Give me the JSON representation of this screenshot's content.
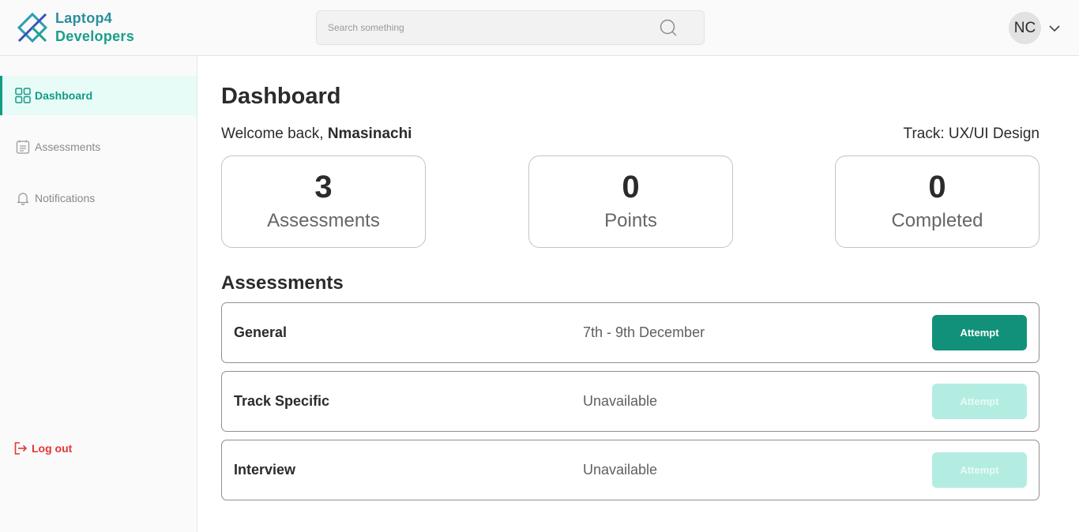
{
  "brand": {
    "line1": "Laptop4",
    "line2": "Developers",
    "colors": {
      "primary": "#139b85",
      "logo_blue": "#3a4fb8",
      "logout_red": "#e53535"
    }
  },
  "search": {
    "placeholder": "Search something",
    "value": "",
    "icon": "search-icon"
  },
  "user": {
    "initials": "NC",
    "menu_icon": "chevron-down-icon"
  },
  "sidebar": {
    "items": [
      {
        "label": "Dashboard",
        "icon": "dashboard-grid-icon",
        "active": true
      },
      {
        "label": "Assessments",
        "icon": "clipboard-list-icon",
        "active": false
      },
      {
        "label": "Notifications",
        "icon": "bell-icon",
        "active": false
      }
    ],
    "logout": {
      "label": "Log out",
      "icon": "logout-icon"
    }
  },
  "main": {
    "title": "Dashboard",
    "welcome_prefix": "Welcome back, ",
    "user_name": "Nmasinachi",
    "track": "Track: UX/UI Design",
    "stats": [
      {
        "value": "3",
        "label": "Assessments"
      },
      {
        "value": "0",
        "label": "Points"
      },
      {
        "value": "0",
        "label": "Completed"
      }
    ],
    "assessments_title": "Assessments",
    "assessments": [
      {
        "name": "General",
        "status": "7th - 9th December",
        "button": "Attempt",
        "enabled": true
      },
      {
        "name": "Track Specific",
        "status": "Unavailable",
        "button": "Attempt",
        "enabled": false
      },
      {
        "name": "Interview",
        "status": "Unavailable",
        "button": "Attempt",
        "enabled": false
      }
    ]
  }
}
